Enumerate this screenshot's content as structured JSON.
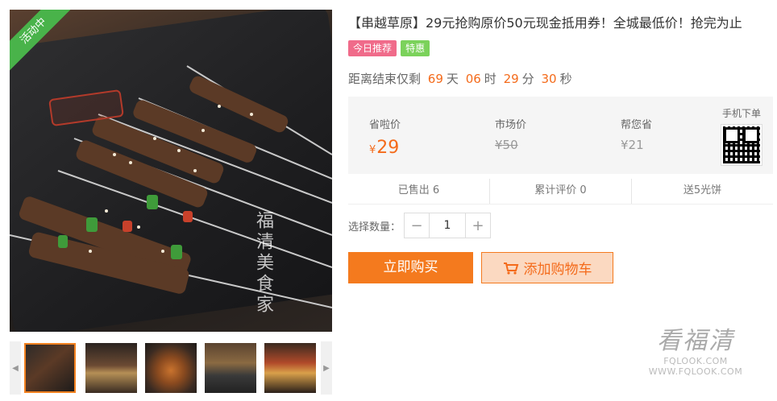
{
  "gallery": {
    "activity_ribbon": "活动中",
    "photo_watermark": "福清美食家",
    "prev_icon": "chevron-left-icon",
    "next_icon": "chevron-right-icon"
  },
  "product": {
    "title": "【串越草原】29元抢购原价50元现金抵用券！全城最低价！抢完为止",
    "badges": [
      "今日推荐",
      "特惠"
    ],
    "colors": {
      "accent": "#f46b1b",
      "badge_today": "#f06b8a",
      "badge_deal": "#7bd25b",
      "ribbon": "#49b34a"
    }
  },
  "countdown": {
    "prefix": "距离结束仅剩",
    "days": "69",
    "days_unit": "天",
    "hours": "06",
    "hours_unit": "时",
    "minutes": "29",
    "minutes_unit": "分",
    "seconds": "30",
    "seconds_unit": "秒"
  },
  "prices": {
    "save_label": "省啦价",
    "save_currency": "¥",
    "save_value": "29",
    "market_label": "市场价",
    "market_value": "¥50",
    "you_save_label": "帮您省",
    "you_save_value": "¥21",
    "mobile_label": "手机下单"
  },
  "stats": {
    "sold": "已售出 6",
    "reviews": "累计评价 0",
    "gift": "送5光饼"
  },
  "quantity": {
    "label": "选择数量：",
    "minus": "−",
    "value": "1",
    "plus": "+"
  },
  "actions": {
    "buy_label": "立即购买",
    "cart_label": "添加购物车",
    "cart_icon": "cart-icon"
  },
  "site_mark": {
    "name": "看福清",
    "domain": "FQLOOK.COM WWW.FQLOOK.COM"
  }
}
